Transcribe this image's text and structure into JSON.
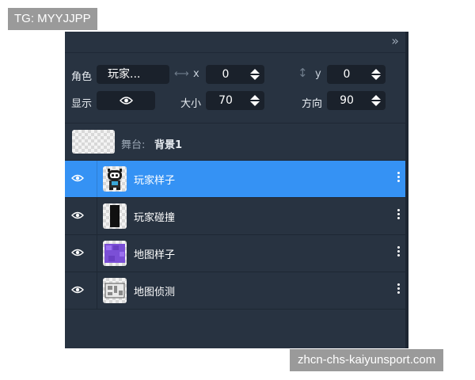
{
  "watermarks": {
    "top": "TG: MYYJJPP",
    "bottom": "zhcn-chs-kaiyunsport.com"
  },
  "toolbar": {
    "collapse_glyph": "»"
  },
  "properties": {
    "role_label": "角色",
    "role_value": "玩家...",
    "x_label": "x",
    "x_value": "0",
    "y_label": "y",
    "y_value": "0",
    "show_label": "显示",
    "size_label": "大小",
    "size_value": "70",
    "direction_label": "方向",
    "direction_value": "90"
  },
  "stage": {
    "label": "舞台:",
    "name": "背景1"
  },
  "sprites": [
    {
      "name": "玩家样子",
      "icon": "robot-sprite-icon",
      "selected": true
    },
    {
      "name": "玩家碰撞",
      "icon": "black-rect-sprite-icon",
      "selected": false
    },
    {
      "name": "地图样子",
      "icon": "purple-tiles-sprite-icon",
      "selected": false
    },
    {
      "name": "地图侦测",
      "icon": "grid-map-sprite-icon",
      "selected": false
    }
  ],
  "colors": {
    "panel": "#283341",
    "selected_row": "#3592f4",
    "input_bg": "#1a212b"
  }
}
